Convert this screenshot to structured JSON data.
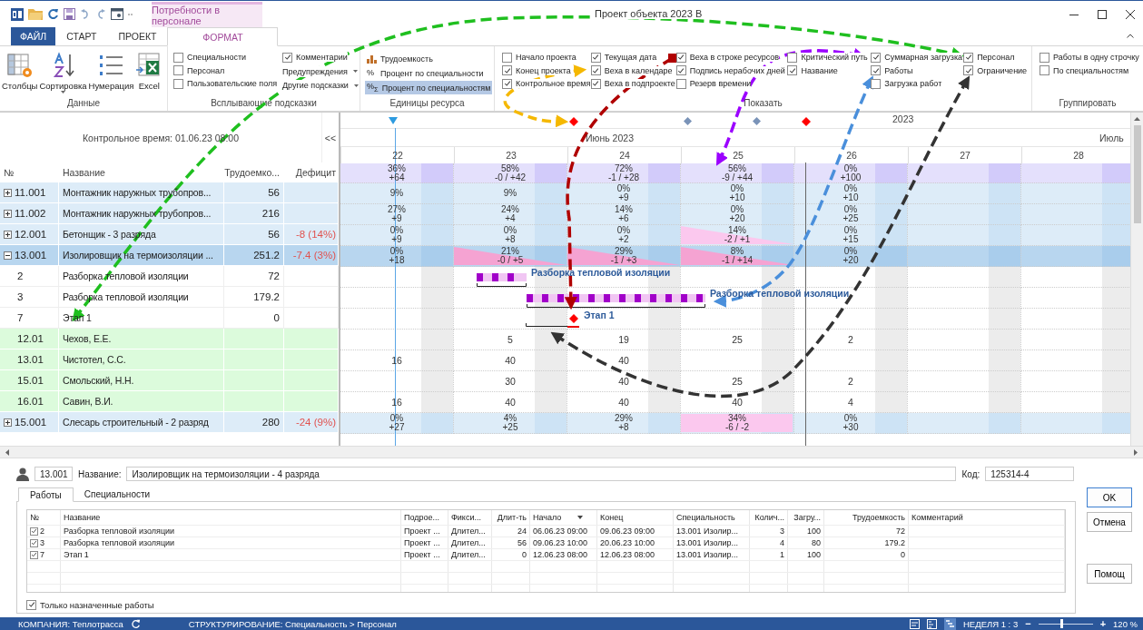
{
  "window": {
    "title": "Проект объекта 2023 В"
  },
  "contextual_tab": "Потребности в персонале",
  "ribbon_tabs": [
    {
      "label": "ФАЙЛ",
      "kind": "file",
      "selected": false
    },
    {
      "label": "СТАРТ",
      "kind": "tab",
      "selected": false
    },
    {
      "label": "ПРОЕКТ",
      "kind": "tab",
      "selected": false
    },
    {
      "label": "ФОРМАТ",
      "kind": "contextual",
      "selected": true
    }
  ],
  "ribbon": {
    "data_group": {
      "label": "Данные",
      "buttons": [
        {
          "label": "Столбцы",
          "kind": "columns",
          "dropdown": false
        },
        {
          "label": "Сортировка",
          "kind": "sort",
          "dropdown": true
        },
        {
          "label": "Нумерация",
          "kind": "numbering",
          "dropdown": false
        },
        {
          "label": "Excel",
          "kind": "excel",
          "dropdown": false
        }
      ]
    },
    "tooltips_group": {
      "label": "Всплывающие подсказки",
      "checkboxes": [
        {
          "label": "Специальности",
          "checked": false
        },
        {
          "label": "Персонал",
          "checked": false
        },
        {
          "label": "Пользовательские поля",
          "checked": false
        },
        {
          "label": "Комментарии",
          "checked": true
        }
      ],
      "dropdowns": [
        "Предупреждения",
        "Другие подсказки"
      ]
    },
    "units_group": {
      "label": "Единицы ресурса",
      "options": [
        {
          "kind": "chart",
          "label": "Трудоемкость",
          "selected": false
        },
        {
          "kind": "symbol",
          "symbol": "%",
          "label": "Процент по специальности",
          "selected": false
        },
        {
          "kind": "symbol",
          "symbol": "%$_{Σ}$",
          "label": "Процент по специальностям",
          "selected": true
        }
      ]
    },
    "show_group": {
      "label": "Показать",
      "columns": [
        [
          {
            "label": "Начало проекта",
            "checked": false
          },
          {
            "label": "Конец проекта",
            "checked": true
          },
          {
            "label": "Контрольное время",
            "checked": true
          }
        ],
        [
          {
            "label": "Текущая дата",
            "checked": true
          },
          {
            "label": "Веха в календаре",
            "checked": true
          },
          {
            "label": "Веха в подпроекте",
            "checked": true
          }
        ],
        [
          {
            "label": "Веха в строке ресурсов",
            "checked": true
          },
          {
            "label": "Подпись нерабочих дней",
            "checked": true
          },
          {
            "label": "Резерв времени",
            "checked": false
          }
        ],
        [
          {
            "label": "Критический путь",
            "checked": false
          },
          {
            "label": "Название",
            "checked": true
          }
        ],
        [
          {
            "label": "Суммарная загрузка",
            "checked": true
          },
          {
            "label": "Работы",
            "checked": true
          },
          {
            "label": "Загрузка работ",
            "checked": false
          }
        ],
        [
          {
            "label": "Персонал",
            "checked": true
          },
          {
            "label": "Ограничение",
            "checked": true
          }
        ]
      ]
    },
    "grouping_group": {
      "label": "Группировать",
      "checkboxes": [
        {
          "label": "Работы в одну строчку",
          "checked": false
        },
        {
          "label": "По специальностям",
          "checked": false
        }
      ]
    }
  },
  "left_panel": {
    "control_time": "Контрольное время: 01.06.23 08:00",
    "collapse": "<<",
    "columns": [
      "№",
      "Название",
      "Трудоемко...",
      "Дефицит"
    ]
  },
  "gantt": {
    "year": "2023",
    "month": "Июнь 2023",
    "next_month": "Июль",
    "days": [
      "22",
      "23",
      "24",
      "25",
      "26",
      "27",
      "28"
    ],
    "summary": [
      {
        "pct": "36%",
        "delta": "+64"
      },
      {
        "pct": "58%",
        "delta": "-0 / +42"
      },
      {
        "pct": "72%",
        "delta": "-1 / +28"
      },
      {
        "pct": "56%",
        "delta": "-9 / +44"
      },
      {
        "pct": "0%",
        "delta": "+100"
      }
    ]
  },
  "rows": [
    {
      "kind": "group",
      "number": "11.001",
      "name": "Монтажник наружных трубопров...",
      "labor": "56",
      "expanded": false,
      "selected": false,
      "load": [
        {
          "kind": "plain",
          "pct": "9%"
        },
        {
          "kind": "plain",
          "pct": "9%"
        },
        {
          "kind": "plain",
          "pct": "0%",
          "delta": "+9"
        },
        {
          "kind": "plain",
          "pct": "0%",
          "delta": "+10"
        },
        {
          "kind": "plain",
          "pct": "0%",
          "delta": "+10"
        }
      ]
    },
    {
      "kind": "group",
      "number": "11.002",
      "name": "Монтажник наружных трубопров...",
      "labor": "216",
      "expanded": false,
      "selected": false,
      "load": [
        {
          "kind": "plain",
          "pct": "27%",
          "delta": "+9"
        },
        {
          "kind": "plain",
          "pct": "24%",
          "delta": "+4"
        },
        {
          "kind": "plain",
          "pct": "14%",
          "delta": "+6"
        },
        {
          "kind": "plain",
          "pct": "0%",
          "delta": "+20"
        },
        {
          "kind": "plain",
          "pct": "0%",
          "delta": "+25"
        }
      ]
    },
    {
      "kind": "group",
      "number": "12.001",
      "name": "Бетонщик - 3 разряда",
      "labor": "56",
      "deficit": "-8 (14%)",
      "expanded": false,
      "selected": false,
      "load": [
        {
          "kind": "plain",
          "pct": "0%",
          "delta": "+9"
        },
        {
          "kind": "plain",
          "pct": "0%",
          "delta": "+8"
        },
        {
          "kind": "plain",
          "pct": "0%",
          "delta": "+2"
        },
        {
          "kind": "partial_deficit",
          "pct": "14%",
          "delta": "-2 / +1"
        },
        {
          "kind": "plain",
          "pct": "0%",
          "delta": "+15"
        }
      ]
    },
    {
      "kind": "group",
      "number": "13.001",
      "name": "Изолировщик на термоизоляции ...",
      "labor": "251.2",
      "deficit": "-7.4 (3%)",
      "expanded": true,
      "selected": true,
      "load": [
        {
          "kind": "plain",
          "pct": "0%",
          "delta": "+18"
        },
        {
          "kind": "partial_deficit",
          "pct": "21%",
          "delta": "-0 / +5"
        },
        {
          "kind": "partial_deficit",
          "pct": "29%",
          "delta": "-1 / +3"
        },
        {
          "kind": "partial_deficit",
          "pct": "8%",
          "delta": "-1 / +14"
        },
        {
          "kind": "plain",
          "pct": "0%",
          "delta": "+20"
        }
      ]
    },
    {
      "kind": "work",
      "number": "2",
      "name": "Разборка тепловой изоляции",
      "labor": "72",
      "selected": false,
      "bar_label": "Разборка тепловой изоляции"
    },
    {
      "kind": "work",
      "number": "3",
      "name": "Разборка тепловой изоляции",
      "labor": "179.2",
      "selected": false,
      "bar_label": "Разборка тепловой изоляции"
    },
    {
      "kind": "milestone",
      "number": "7",
      "name": "Этап 1",
      "labor": "0",
      "selected": false,
      "bar_label": "Этап 1"
    },
    {
      "kind": "person",
      "number": "12.01",
      "name": "Чехов, Е.Е.",
      "selected": false,
      "hours": [
        {
          "kind": "empty"
        },
        {
          "kind": "value",
          "value": "5"
        },
        {
          "kind": "value",
          "value": "19"
        },
        {
          "kind": "value",
          "value": "25"
        },
        {
          "kind": "value",
          "value": "2"
        }
      ]
    },
    {
      "kind": "person",
      "number": "13.01",
      "name": "Чистотел, С.С.",
      "selected": false,
      "hours": [
        {
          "kind": "value",
          "value": "16"
        },
        {
          "kind": "value",
          "value": "40"
        },
        {
          "kind": "value",
          "value": "40"
        }
      ]
    },
    {
      "kind": "person",
      "number": "15.01",
      "name": "Смольский, Н.Н.",
      "selected": false,
      "hours": [
        {
          "kind": "empty"
        },
        {
          "kind": "value",
          "value": "30"
        },
        {
          "kind": "value",
          "value": "40"
        },
        {
          "kind": "value",
          "value": "25"
        },
        {
          "kind": "value",
          "value": "2"
        }
      ]
    },
    {
      "kind": "person",
      "number": "16.01",
      "name": "Савин, В.И.",
      "selected": false,
      "hours": [
        {
          "kind": "value",
          "value": "16"
        },
        {
          "kind": "value",
          "value": "40"
        },
        {
          "kind": "value",
          "value": "40"
        },
        {
          "kind": "value",
          "value": "40"
        },
        {
          "kind": "value",
          "value": "4"
        }
      ]
    },
    {
      "kind": "group",
      "number": "15.001",
      "name": "Слесарь строительный - 2 разряд",
      "labor": "280",
      "deficit": "-24 (9%)",
      "expanded": false,
      "selected": false,
      "load": [
        {
          "kind": "plain",
          "pct": "0%",
          "delta": "+27"
        },
        {
          "kind": "plain",
          "pct": "4%",
          "delta": "+25"
        },
        {
          "kind": "plain",
          "pct": "29%",
          "delta": "+8"
        },
        {
          "kind": "full_deficit",
          "pct": "34%",
          "delta": "-6 / -2"
        },
        {
          "kind": "plain",
          "pct": "0%",
          "delta": "+30"
        }
      ]
    }
  ],
  "details": {
    "id": "13.001",
    "name_label": "Название:",
    "name": "Изолировщик на термоизоляции - 4 разряда",
    "code_label": "Код:",
    "code": "125314-4",
    "tabs": [
      {
        "label": "Работы",
        "selected": true
      },
      {
        "label": "Специальности",
        "selected": false
      }
    ],
    "columns": [
      {
        "label": "№",
        "numeric": false
      },
      {
        "label": "Название",
        "numeric": false
      },
      {
        "label": "Подрое...",
        "numeric": false
      },
      {
        "label": "Фикси...",
        "numeric": false
      },
      {
        "label": "Длит-ть",
        "numeric": true
      },
      {
        "label": "Начало",
        "numeric": false,
        "sorted": true
      },
      {
        "label": "Конец",
        "numeric": false
      },
      {
        "label": "Специальность",
        "numeric": false
      },
      {
        "label": "Колич...",
        "numeric": true
      },
      {
        "label": "Загру...",
        "numeric": true
      },
      {
        "label": "Трудоемкость",
        "numeric": true
      },
      {
        "label": "Комментарий",
        "numeric": false
      }
    ],
    "rows": [
      {
        "checked": true,
        "cells": [
          "2",
          "Разборка тепловой изоляции",
          "Проект ...",
          "Длител...",
          "24",
          "06.06.23 09:00",
          "09.06.23 09:00",
          "13.001 Изолир...",
          "3",
          "100",
          "72"
        ]
      },
      {
        "checked": true,
        "cells": [
          "3",
          "Разборка тепловой изоляции",
          "Проект ...",
          "Длител...",
          "56",
          "09.06.23 10:00",
          "20.06.23 10:00",
          "13.001 Изолир...",
          "4",
          "80",
          "179.2"
        ]
      },
      {
        "checked": true,
        "cells": [
          "7",
          "Этап 1",
          "Проект ...",
          "Длител...",
          "0",
          "12.06.23 08:00",
          "12.06.23 08:00",
          "13.001 Изолир...",
          "1",
          "100",
          "0"
        ]
      }
    ],
    "only_assigned": {
      "label": "Только назначенные работы",
      "checked": true
    },
    "buttons": [
      "OK",
      "Отмена",
      "Помощ"
    ]
  },
  "status_bar": {
    "company": "КОМПАНИЯ: Теплотрасса",
    "structure": "СТРУКТУРИРОВАНИЕ: Специальность > Персонал",
    "week": "НЕДЕЛЯ 1 : 3",
    "zoom_out": "−",
    "zoom_in": "+",
    "zoom": {
      "level": 0.42
    },
    "zoom_value": "120 %"
  }
}
